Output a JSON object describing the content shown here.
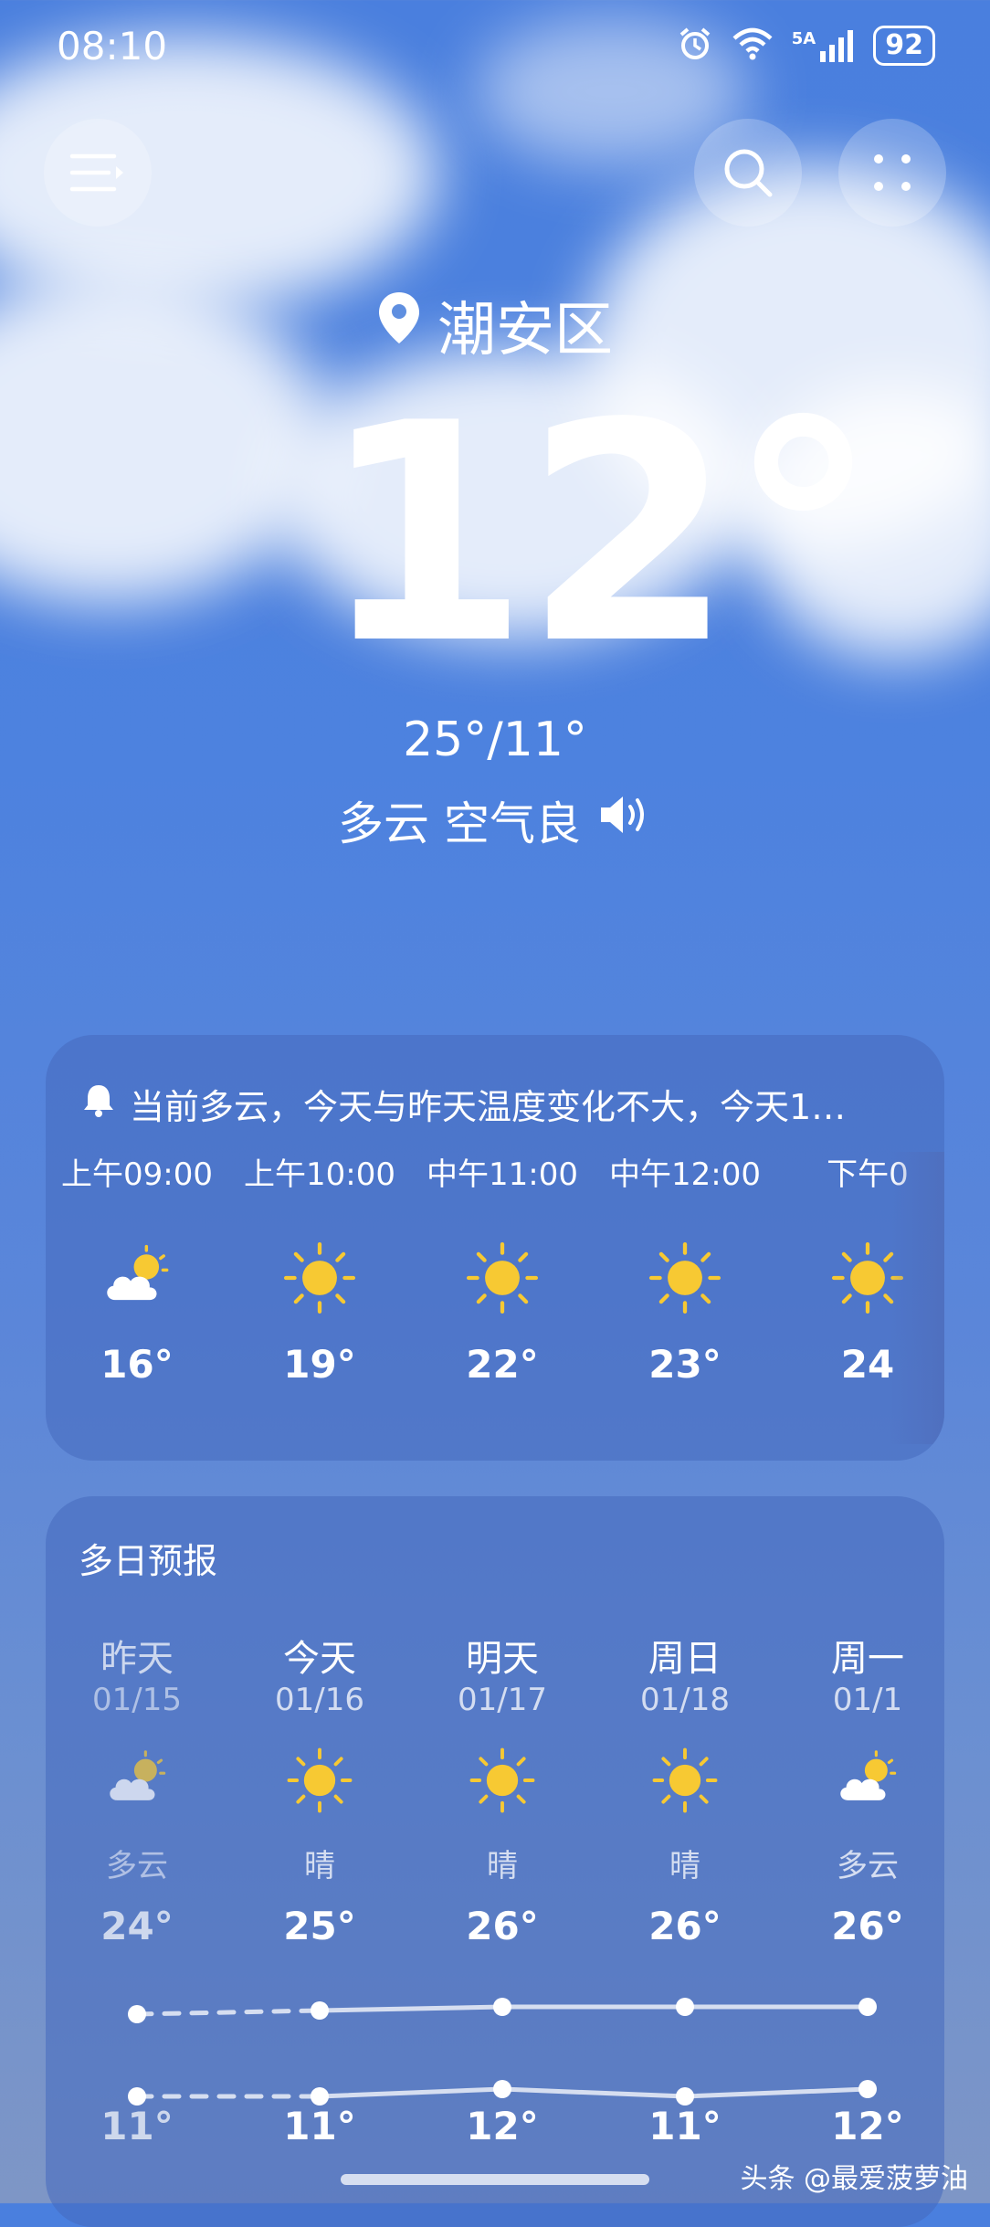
{
  "status_bar": {
    "time": "08:10",
    "network": "5A",
    "battery": "92"
  },
  "location": "潮安区",
  "current_temp": "12°",
  "temp_range": "25°/11°",
  "condition": "多云 空气良",
  "alert_text": "当前多云，今天与昨天温度变化不大，今天1…",
  "hourly": [
    {
      "time": "上午09:00",
      "icon": "partly-cloudy-icon",
      "temp": "16°"
    },
    {
      "time": "上午10:00",
      "icon": "sun-icon",
      "temp": "19°"
    },
    {
      "time": "中午11:00",
      "icon": "sun-icon",
      "temp": "22°"
    },
    {
      "time": "中午12:00",
      "icon": "sun-icon",
      "temp": "23°"
    },
    {
      "time": "下午0",
      "icon": "sun-icon",
      "temp": "24"
    }
  ],
  "forecast_title": "多日预报",
  "daily": [
    {
      "day": "昨天",
      "date": "01/15",
      "icon": "partly-cloudy-icon",
      "cond": "多云",
      "high": "24°",
      "low": "11°"
    },
    {
      "day": "今天",
      "date": "01/16",
      "icon": "sun-icon",
      "cond": "晴",
      "high": "25°",
      "low": "11°"
    },
    {
      "day": "明天",
      "date": "01/17",
      "icon": "sun-icon",
      "cond": "晴",
      "high": "26°",
      "low": "12°"
    },
    {
      "day": "周日",
      "date": "01/18",
      "icon": "sun-icon",
      "cond": "晴",
      "high": "26°",
      "low": "11°"
    },
    {
      "day": "周一",
      "date": "01/1",
      "icon": "partly-cloudy-icon",
      "cond": "多云",
      "high": "26°",
      "low": "12°"
    }
  ],
  "watermark": "头条 @最爱菠萝油",
  "colors": {
    "sun": "#f7c933",
    "sky": "#4a7fde"
  }
}
